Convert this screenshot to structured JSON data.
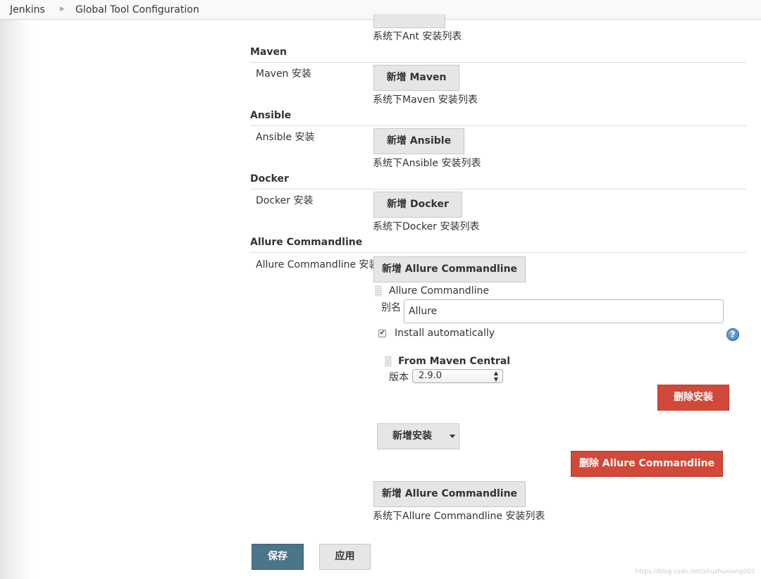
{
  "breadcrumb": {
    "home": "Jenkins",
    "page": "Global Tool Configuration"
  },
  "ant": {
    "list_help": "系统下Ant 安装列表"
  },
  "maven": {
    "title": "Maven",
    "label": "Maven 安装",
    "add_button": "新增 Maven",
    "list_help": "系统下Maven 安装列表"
  },
  "ansible": {
    "title": "Ansible",
    "label": "Ansible 安装",
    "add_button": "新增 Ansible",
    "list_help": "系统下Ansible 安装列表"
  },
  "docker": {
    "title": "Docker",
    "label": "Docker 安装",
    "add_button": "新增 Docker",
    "list_help": "系统下Docker 安装列表"
  },
  "allure": {
    "title": "Allure Commandline",
    "label": "Allure Commandline 安装",
    "add_button": "新增 Allure Commandline",
    "installation": {
      "header": "Allure Commandline",
      "alias_label": "别名",
      "alias_value": "Allure",
      "install_auto_label": "Install automatically",
      "install_auto_checked": true,
      "installer": {
        "title": "From Maven Central",
        "version_label": "版本",
        "version_value": "2.9.0"
      },
      "delete_installer_button": "删除安装",
      "add_installer_button": "新增安装"
    },
    "delete_button": "删除 Allure Commandline",
    "add_button_bottom": "新增 Allure Commandline",
    "list_help": "系统下Allure Commandline 安装列表"
  },
  "footer": {
    "save": "保存",
    "apply": "应用"
  },
  "watermark": "https://blog.csdn.net/zhuzhuxiang001",
  "colors": {
    "danger": "#d24939",
    "primary": "#4b758b",
    "button_gray": "#e6e6e6"
  }
}
